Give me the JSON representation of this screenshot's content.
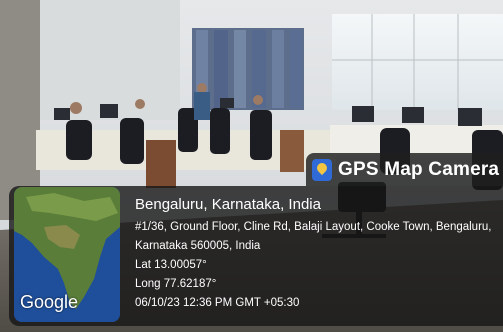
{
  "overlay": {
    "app_title": "GPS Map Camera",
    "map_logo": "Google",
    "place": "Bengaluru, Karnataka, India",
    "address_line1": "#1/36, Ground Floor, Cline Rd, Balaji Layout, Cooke Town, Bengaluru,",
    "address_line2": "Karnataka 560005, India",
    "latitude": "Lat 13.00057°",
    "longitude": "Long 77.62187°",
    "timestamp": "06/10/23 12:36 PM GMT +05:30"
  },
  "colors": {
    "panel": "#161616",
    "map_water": "#1f4f9a",
    "map_land": "#5a7d3a",
    "logo": "#2f6ad6",
    "pin": "#f4c542"
  },
  "icons": {
    "app_logo": "map-pin-icon"
  }
}
